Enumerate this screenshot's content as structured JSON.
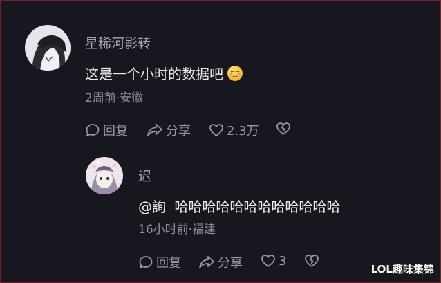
{
  "comments": [
    {
      "author": "星稀河影转",
      "text": "这是一个小时的数据吧",
      "emoji": "embarrassed-smile-emoji",
      "meta": "2周前·安徽",
      "actions": {
        "reply": "回复",
        "share": "分享",
        "like_count": "2.3万"
      }
    },
    {
      "author": "迟",
      "mention": "@詢",
      "text": "哈哈哈哈哈哈哈哈哈哈哈哈",
      "meta": "16小时前·福建",
      "actions": {
        "reply": "回复",
        "share": "分享",
        "like_count": "3"
      }
    }
  ],
  "watermark": "LOL趣味集锦",
  "colors": {
    "background": "#16171f",
    "frame": "#7a1f27",
    "muted": "#9a9aa3"
  }
}
